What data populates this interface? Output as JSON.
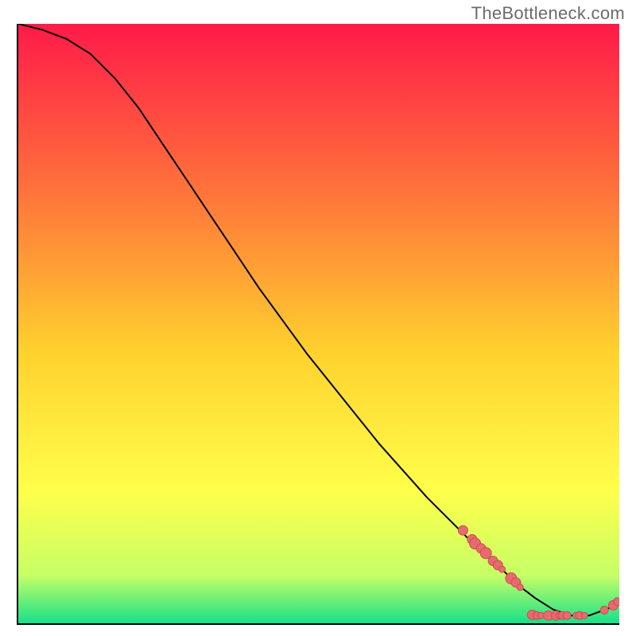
{
  "watermark": "TheBottleneck.com",
  "chart_data": {
    "type": "line",
    "title": "",
    "xlabel": "",
    "ylabel": "",
    "xlim": [
      0,
      100
    ],
    "ylim": [
      0,
      100
    ],
    "background_gradient": {
      "top": "#ff1a49",
      "mid1": "#ff7a3a",
      "mid2": "#ffd22e",
      "mid3": "#ffff4a",
      "mid4": "#c6ff66",
      "bottom": "#18e08a"
    },
    "curve": {
      "name": "bottleneck-curve",
      "x": [
        0,
        4,
        8,
        12,
        16,
        20,
        24,
        28,
        32,
        36,
        40,
        44,
        48,
        52,
        56,
        60,
        64,
        68,
        72,
        76,
        80,
        83,
        86,
        89,
        92,
        95,
        98,
        100
      ],
      "y": [
        100,
        99,
        97.5,
        95,
        91,
        86,
        80,
        74,
        68,
        62,
        56,
        50.5,
        45,
        40,
        35,
        30,
        25.5,
        21,
        17,
        13,
        9.5,
        6.5,
        4.2,
        2.3,
        1.3,
        1.3,
        2.4,
        3.4
      ]
    },
    "marker_color": "#e86a6f",
    "marker_stroke": "#c94d52",
    "markers": [
      {
        "x": 74.0,
        "y": 15.5,
        "r": 6
      },
      {
        "x": 75.5,
        "y": 14.0,
        "r": 6
      },
      {
        "x": 76.0,
        "y": 13.3,
        "r": 7
      },
      {
        "x": 77.0,
        "y": 12.5,
        "r": 6
      },
      {
        "x": 77.8,
        "y": 11.7,
        "r": 7
      },
      {
        "x": 79.0,
        "y": 10.4,
        "r": 6
      },
      {
        "x": 79.8,
        "y": 9.7,
        "r": 6
      },
      {
        "x": 80.5,
        "y": 9.0,
        "r": 4
      },
      {
        "x": 82.0,
        "y": 7.5,
        "r": 7
      },
      {
        "x": 82.8,
        "y": 6.8,
        "r": 6
      },
      {
        "x": 83.5,
        "y": 6.0,
        "r": 4
      },
      {
        "x": 85.5,
        "y": 1.4,
        "r": 6
      },
      {
        "x": 86.3,
        "y": 1.3,
        "r": 5
      },
      {
        "x": 87.0,
        "y": 1.3,
        "r": 4
      },
      {
        "x": 88.2,
        "y": 1.3,
        "r": 6
      },
      {
        "x": 89.5,
        "y": 1.3,
        "r": 6
      },
      {
        "x": 90.0,
        "y": 1.3,
        "r": 4
      },
      {
        "x": 90.5,
        "y": 1.3,
        "r": 5
      },
      {
        "x": 91.3,
        "y": 1.3,
        "r": 5
      },
      {
        "x": 92.8,
        "y": 1.3,
        "r": 4
      },
      {
        "x": 93.4,
        "y": 1.3,
        "r": 5
      },
      {
        "x": 94.2,
        "y": 1.3,
        "r": 4
      },
      {
        "x": 97.5,
        "y": 2.2,
        "r": 5
      },
      {
        "x": 99.0,
        "y": 3.0,
        "r": 6
      },
      {
        "x": 99.7,
        "y": 3.6,
        "r": 5
      }
    ]
  }
}
